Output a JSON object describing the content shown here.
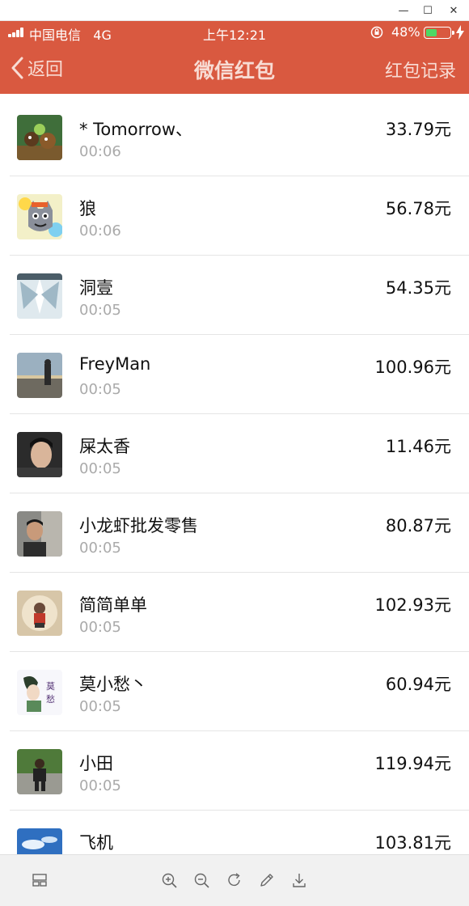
{
  "window": {
    "minimize_glyph": "—",
    "maximize_glyph": "☐",
    "close_glyph": "✕"
  },
  "status_bar": {
    "carrier": "中国电信",
    "network": "4G",
    "time": "上午12:21",
    "battery_percent": "48%",
    "battery_level": 0.48
  },
  "nav": {
    "back_label": "返回",
    "title": "微信红包",
    "right_label": "红包记录"
  },
  "records": [
    {
      "name": "* Tomorrow、",
      "time": "00:06",
      "amount": "33.79元",
      "avatar": "cartoon-bears-avatar"
    },
    {
      "name": "狼",
      "time": "00:06",
      "amount": "56.78元",
      "avatar": "grey-wolf-avatar"
    },
    {
      "name": "洞壹",
      "time": "00:05",
      "amount": "54.35元",
      "avatar": "ice-art-avatar"
    },
    {
      "name": "FreyMan",
      "time": "00:05",
      "amount": "100.96元",
      "avatar": "beach-sunset-avatar"
    },
    {
      "name": "屎太香",
      "time": "00:05",
      "amount": "11.46元",
      "avatar": "actor-portrait-avatar"
    },
    {
      "name": "小龙虾批发零售",
      "time": "00:05",
      "amount": "80.87元",
      "avatar": "car-selfie-avatar"
    },
    {
      "name": "简简单单",
      "time": "00:05",
      "amount": "102.93元",
      "avatar": "child-photo-avatar"
    },
    {
      "name": "莫小愁丶",
      "time": "00:05",
      "amount": "60.94元",
      "avatar": "anime-character-avatar"
    },
    {
      "name": "小田",
      "time": "00:05",
      "amount": "119.94元",
      "avatar": "outdoor-person-avatar"
    },
    {
      "name": "飞机",
      "time": "",
      "amount": "103.81元",
      "avatar": "blue-sky-avatar"
    }
  ],
  "colors": {
    "header": "#d95940",
    "header_text": "#f8dcd4",
    "amount_text": "#111111",
    "time_text": "#aaaaaa"
  },
  "toolbar_icons": [
    "thumbnails-icon",
    "zoom-in-icon",
    "zoom-out-icon",
    "rotate-icon",
    "edit-icon",
    "download-icon"
  ]
}
